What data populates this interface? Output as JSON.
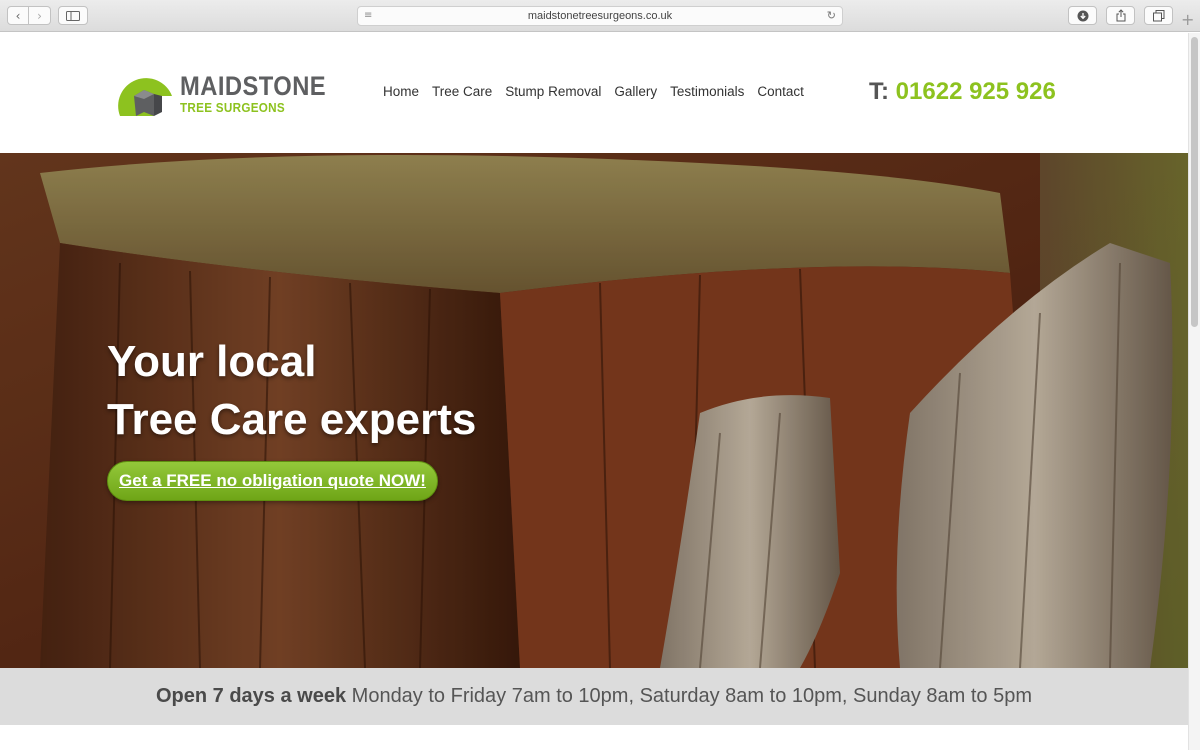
{
  "browser": {
    "url": "maidstonetreesurgeons.co.uk",
    "back_icon": "chevron-left-icon",
    "forward_icon": "chevron-right-icon",
    "sidebar_icon": "sidebar-icon",
    "reader_icon": "reader-lines-icon",
    "reload_icon": "reload-icon",
    "download_icon": "download-icon",
    "share_icon": "share-icon",
    "tabs_icon": "tabs-overview-icon",
    "new_tab_icon": "plus-icon"
  },
  "header": {
    "logo_main": "MAIDSTONE",
    "logo_sub": "TREE SURGEONS",
    "nav": [
      "Home",
      "Tree Care",
      "Stump Removal",
      "Gallery",
      "Testimonials",
      "Contact"
    ],
    "phone_prefix": "T:",
    "phone_number": "01622 925 926"
  },
  "hero": {
    "headline_line1": "Your local",
    "headline_line2": "Tree Care experts",
    "cta_label": "Get a FREE no obligation quote NOW!"
  },
  "hours": {
    "lead": "Open 7 days a week",
    "detail": "Monday to Friday 7am to 10pm, Saturday 8am to 10pm, Sunday 8am to 5pm"
  },
  "colors": {
    "brand_green": "#8dc21f",
    "logo_grey": "#5e5f61",
    "hours_bar": "#dcdcdc"
  }
}
